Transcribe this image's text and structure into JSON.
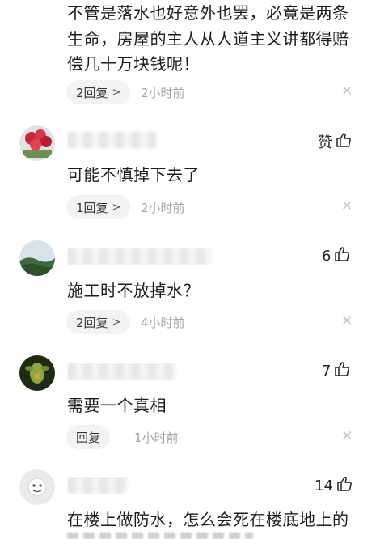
{
  "comment0": {
    "text_lines": [
      "不管是落水也好意外也罢，必竟是两条",
      "生命，房屋的主人从人道主义讲都得赔",
      "偿几十万块钱呢！"
    ],
    "reply_label": "2回复",
    "time": "2小时前"
  },
  "comments": [
    {
      "username": "",
      "like_label": "赞",
      "text": "可能不慎掉下去了",
      "reply_label": "1回复",
      "time": "2小时前"
    },
    {
      "username": "",
      "like_label": "6",
      "text": "施工时不放掉水？",
      "reply_label": "2回复",
      "time": "4小时前"
    },
    {
      "username": "",
      "like_label": "7",
      "text": "需要一个真相",
      "reply_label": "回复",
      "time": "1小时前"
    },
    {
      "username": "",
      "like_label": "14",
      "text": "在楼上做防水，怎么会死在楼底地上的",
      "reply_label": "",
      "time": ""
    }
  ],
  "icons": {
    "like": "thumbs-up-icon",
    "close": "close-icon",
    "chevron": "chevron-right-icon"
  }
}
